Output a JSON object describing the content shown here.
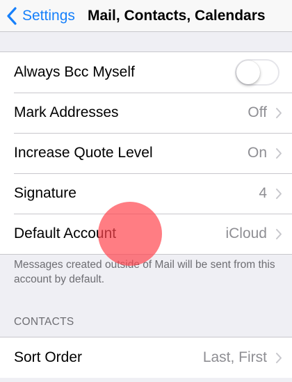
{
  "navbar": {
    "back_label": "Settings",
    "back_icon": "chevron-left-icon",
    "title": "Mail, Contacts, Calendars"
  },
  "mail_settings": {
    "always_bcc": {
      "label": "Always Bcc Myself",
      "enabled": false
    },
    "mark_addresses": {
      "label": "Mark Addresses",
      "value": "Off"
    },
    "increase_quote_level": {
      "label": "Increase Quote Level",
      "value": "On"
    },
    "signature": {
      "label": "Signature",
      "value": "4"
    },
    "default_account": {
      "label": "Default Account",
      "value": "iCloud"
    },
    "footer": "Messages created outside of Mail will be sent from this account by default."
  },
  "contacts": {
    "header": "CONTACTS",
    "sort_order": {
      "label": "Sort Order",
      "value": "Last, First"
    }
  },
  "colors": {
    "accent": "#1680fb",
    "background": "#efeff4",
    "secondary_text": "#8e8e93",
    "touch_indicator": "#ff464e"
  }
}
